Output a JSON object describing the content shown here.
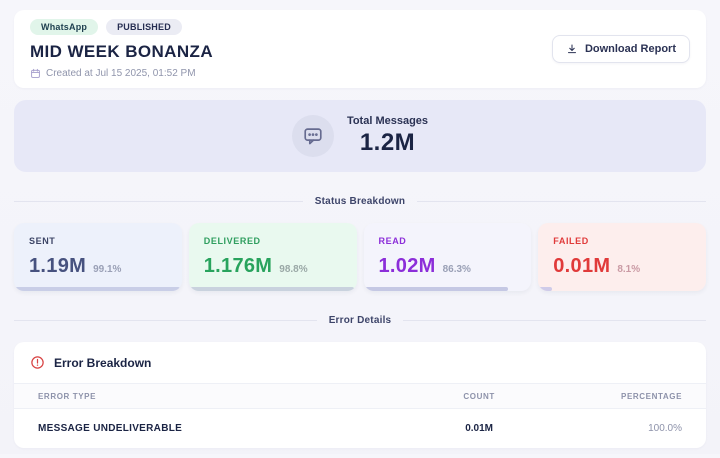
{
  "theme": {
    "page_bg": "#f4f5fa",
    "text_dark": "#1b2444",
    "text_muted": "#9095ac",
    "divider_line": "#e3e4ef",
    "whatsapp_badge_bg": "#e1f5ea",
    "published_badge_bg": "#ebecf4",
    "sent_color": "#47527f",
    "delivered_color": "#28a35d",
    "read_color": "#8c2ed9",
    "failed_color": "#e03a3a"
  },
  "header": {
    "channel_badge": "WhatsApp",
    "status_badge": "PUBLISHED",
    "title": "MID WEEK BONANZA",
    "created_at": "Created at Jul 15 2025, 01:52 PM",
    "download_button": "Download Report",
    "icons": {
      "calendar": "calendar-icon",
      "download": "download-icon"
    }
  },
  "summary": {
    "label": "Total Messages",
    "value": "1.2M",
    "icon": "chat-bubble-icon"
  },
  "sections": {
    "status_breakdown": "Status Breakdown",
    "error_details": "Error Details"
  },
  "status_cards": [
    {
      "label": "SENT",
      "value": "1.19M",
      "pct": "99.1%",
      "bar_width": "99.1%",
      "bg": "#edf1fb",
      "label_color": "#3d4566",
      "value_color": "#47527f",
      "pct_color": "#9aa0b6",
      "bar_color": "#c9cee7"
    },
    {
      "label": "DELIVERED",
      "value": "1.176M",
      "pct": "98.8%",
      "bar_width": "98.8%",
      "bg": "#e9f9ef",
      "label_color": "#2f9e5f",
      "value_color": "#28a35d",
      "pct_color": "#9aa8a6",
      "bar_color": "#c9d2de"
    },
    {
      "label": "READ",
      "value": "1.02M",
      "pct": "86.3%",
      "bar_width": "86.3%",
      "bg": "#f4f4fc",
      "label_color": "#8c2ed9",
      "value_color": "#8c2ed9",
      "pct_color": "#9aa0b6",
      "bar_color": "#c5c8e4"
    },
    {
      "label": "FAILED",
      "value": "0.01M",
      "pct": "8.1%",
      "bar_width": "8.1%",
      "bg": "#fdeeed",
      "label_color": "#e03a3a",
      "value_color": "#e03a3a",
      "pct_color": "#ca9aa4",
      "bar_color": "#cfcbe9"
    }
  ],
  "error_breakdown": {
    "title": "Error Breakdown",
    "icon": "alert-circle-icon",
    "columns": {
      "type": "ERROR TYPE",
      "count": "COUNT",
      "percentage": "PERCENTAGE"
    },
    "rows": [
      {
        "type": "MESSAGE UNDELIVERABLE",
        "count": "0.01M",
        "percentage": "100.0%"
      }
    ]
  }
}
